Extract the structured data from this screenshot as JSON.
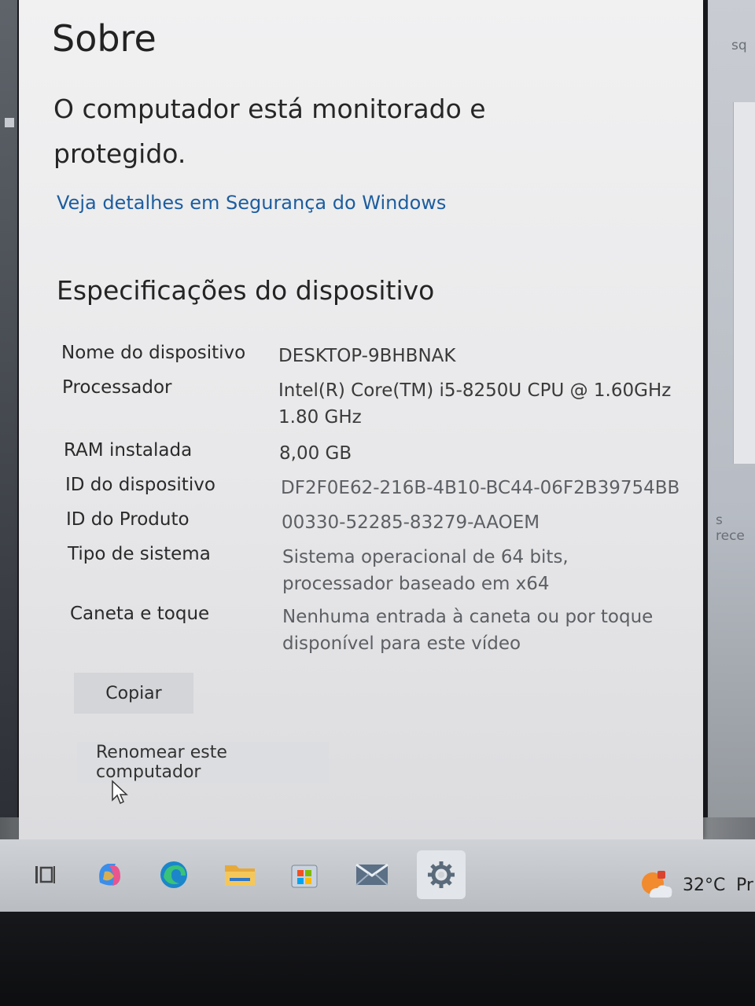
{
  "page": {
    "title": "Sobre",
    "status_message": "O computador está monitorado e protegido.",
    "security_link": "Veja detalhes em Segurança do Windows"
  },
  "specs": {
    "heading": "Especificações do dispositivo",
    "rows": [
      {
        "label": "Nome do dispositivo",
        "value": "DESKTOP-9BHBNAK"
      },
      {
        "label": "Processador",
        "value": "Intel(R) Core(TM) i5-8250U CPU @ 1.60GHz 1.80 GHz"
      },
      {
        "label": "RAM instalada",
        "value": "8,00 GB"
      },
      {
        "label": "ID do dispositivo",
        "value": "DF2F0E62-216B-4B10-BC44-06F2B39754BB"
      },
      {
        "label": "ID do Produto",
        "value": "00330-52285-83279-AAOEM"
      },
      {
        "label": "Tipo de sistema",
        "value": "Sistema operacional de 64 bits, processador baseado em x64"
      },
      {
        "label": "Caneta e toque",
        "value": "Nenhuma entrada à caneta ou por toque disponível para este vídeo"
      }
    ]
  },
  "buttons": {
    "copy": "Copiar",
    "rename": "Renomear este computador"
  },
  "background_fragments": {
    "top_right": "sq",
    "mid_right": "s rece"
  },
  "taskbar": {
    "icons": [
      "task-view-icon",
      "copilot-icon",
      "edge-icon",
      "file-explorer-icon",
      "microsoft-store-icon",
      "mail-icon",
      "settings-icon"
    ],
    "active": "settings-icon",
    "weather_temp": "32°C",
    "tray_fragment": "Pr"
  },
  "colors": {
    "link": "#1d5d9e",
    "window_bg": "#f1f1f2",
    "taskbar_bg": "#cfd2d6"
  }
}
